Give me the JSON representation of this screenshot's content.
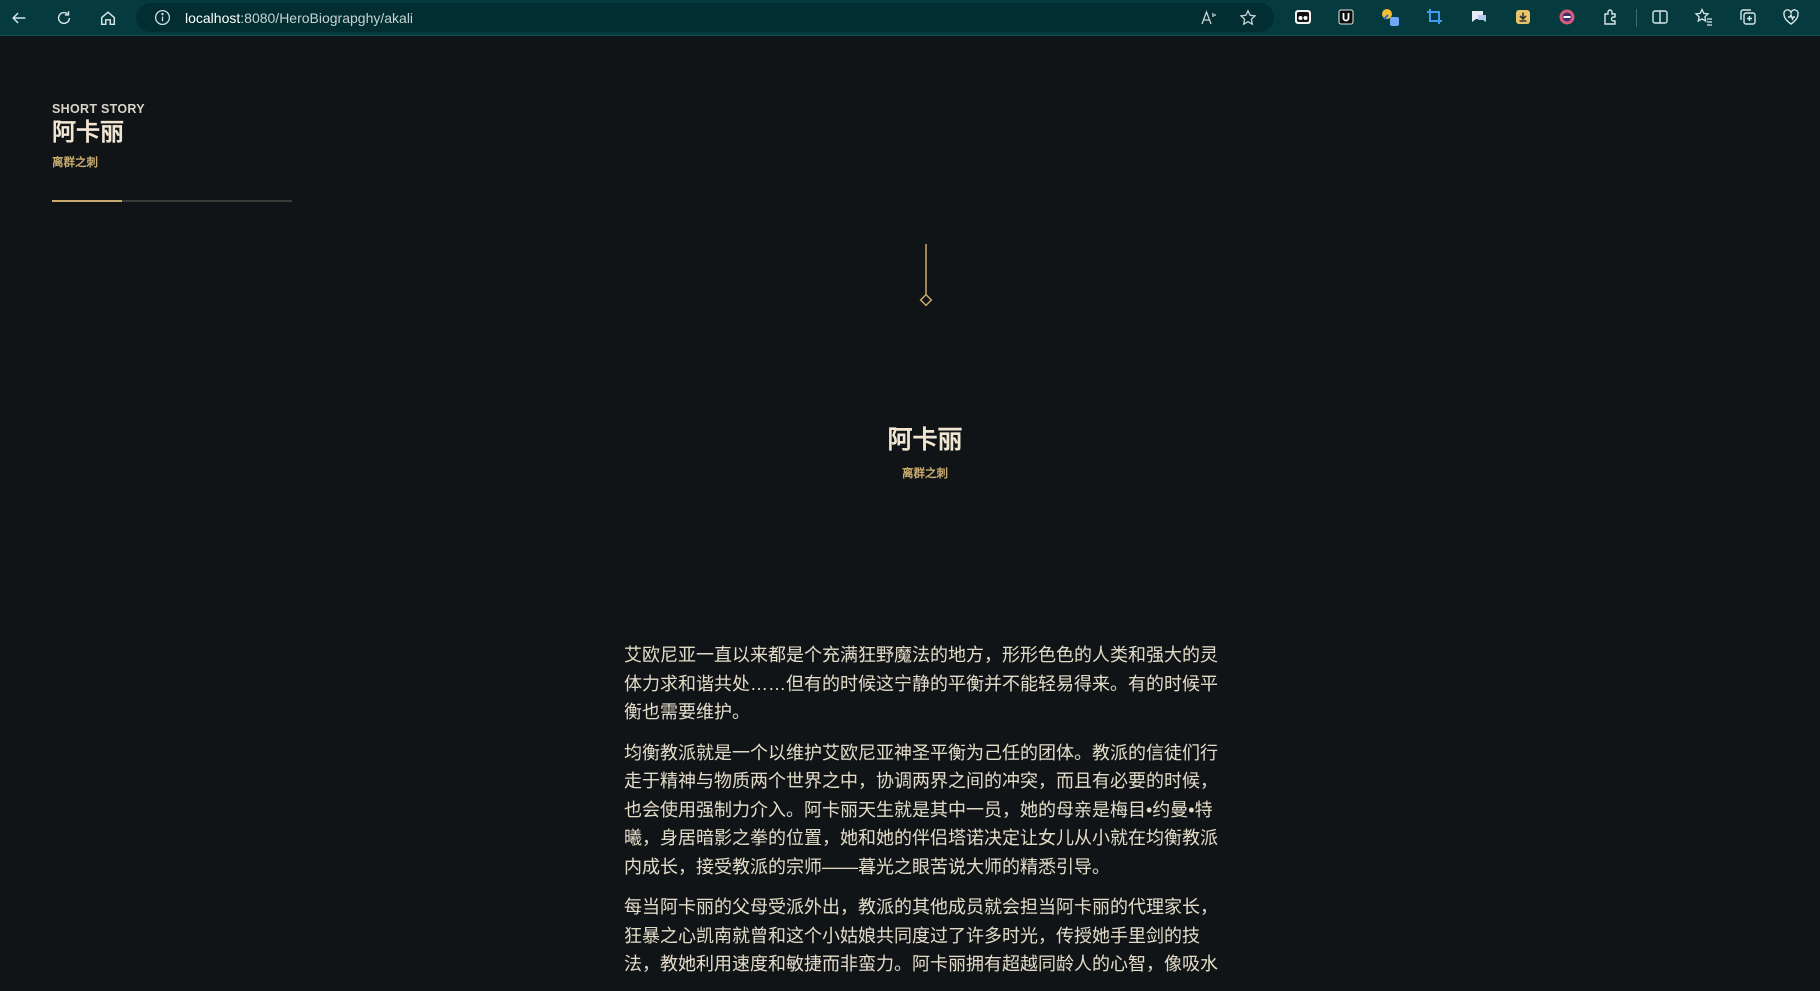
{
  "browser": {
    "url_host": "localhost",
    "url_rest": ":8080/HeroBiograpghy/akali"
  },
  "side": {
    "label": "SHORT STORY",
    "title": "阿卡丽",
    "subtitle": "离群之刺",
    "progress": 0.29
  },
  "hero": {
    "title": "阿卡丽",
    "subtitle": "离群之刺"
  },
  "story": {
    "paragraphs": [
      "艾欧尼亚一直以来都是个充满狂野魔法的地方，形形色色的人类和强大的灵体力求和谐共处……但有的时候这宁静的平衡并不能轻易得来。有的时候平衡也需要维护。",
      "均衡教派就是一个以维护艾欧尼亚神圣平衡为己任的团体。教派的信徒们行走于精神与物质两个世界之中，协调两界之间的冲突，而且有必要的时候，也会使用强制力介入。阿卡丽天生就是其中一员，她的母亲是梅目•约曼•特曦，身居暗影之拳的位置，她和她的伴侣塔诺决定让女儿从小就在均衡教派内成长，接受教派的宗师——暮光之眼苦说大师的精悉引导。",
      "每当阿卡丽的父母受派外出，教派的其他成员就会担当阿卡丽的代理家长，狂暴之心凯南就曾和这个小姑娘共同度过了许多时光，传授她手里剑的技法，教她利用速度和敏捷而非蛮力。阿卡丽拥有超越同龄人的心智，像吸水"
    ]
  },
  "icons": {
    "back": "back-arrow-icon",
    "refresh": "refresh-icon",
    "home": "home-icon",
    "info": "info-icon",
    "read_aloud": "read-aloud-icon",
    "favorite": "star-icon"
  },
  "colors": {
    "background": "#111417",
    "accent_gold": "#c8aa6e",
    "title_text": "#f0e6d2",
    "browser_bar": "#053b3f"
  }
}
